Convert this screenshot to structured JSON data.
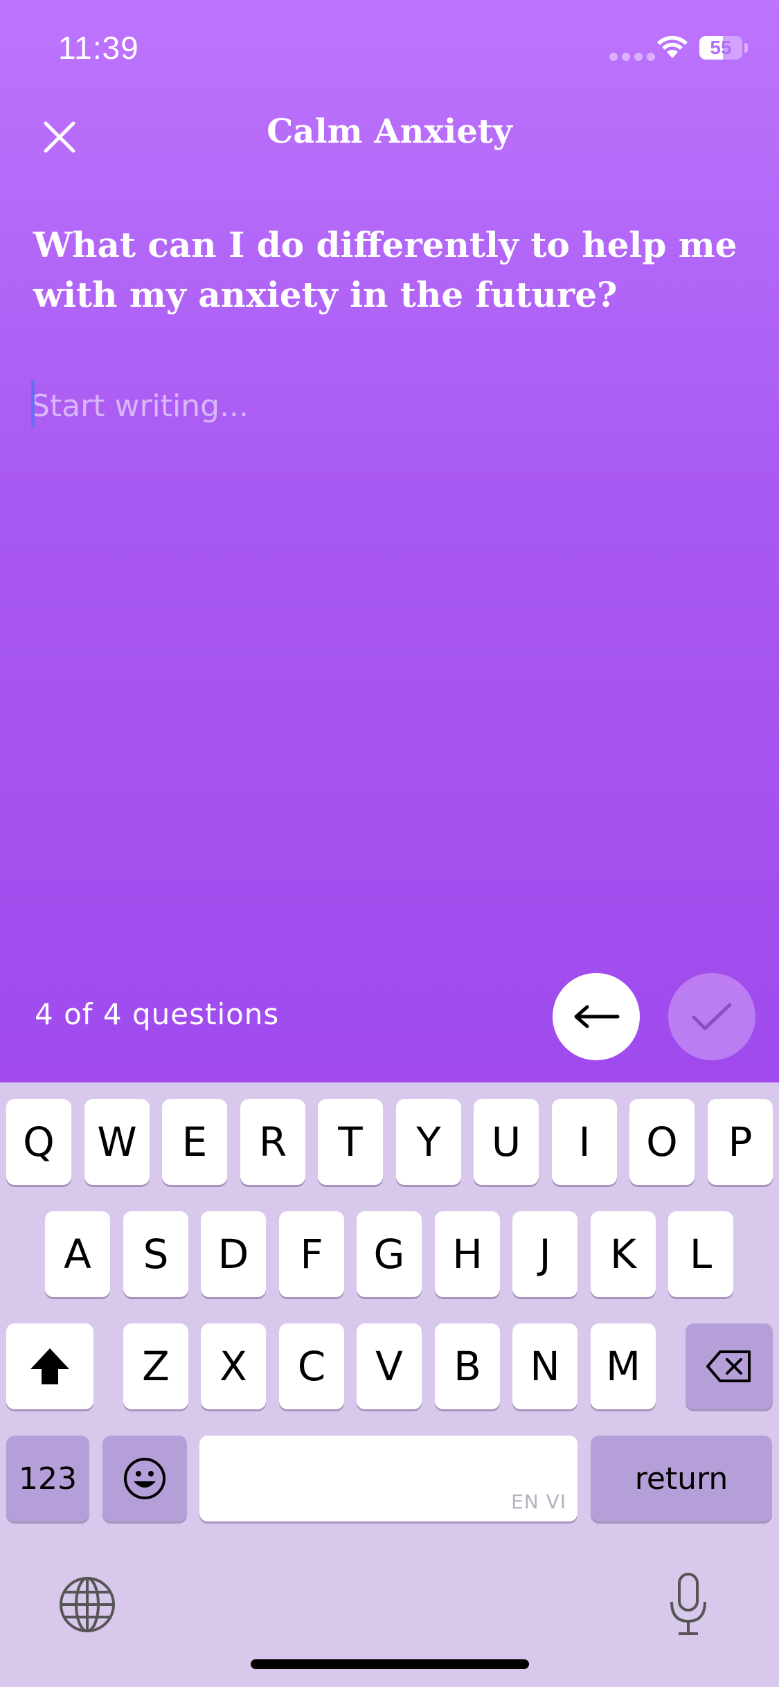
{
  "status_bar": {
    "time": "11:39",
    "battery": "55",
    "battery_level": 0.55
  },
  "nav": {
    "title": "Calm Anxiety"
  },
  "question": {
    "text": "What can I do differently to help me with my anxiety in the future?"
  },
  "answer": {
    "placeholder": "Start writing...",
    "value": ""
  },
  "footer": {
    "progress": "4 of 4 questions"
  },
  "keyboard": {
    "row1": [
      "Q",
      "W",
      "E",
      "R",
      "T",
      "Y",
      "U",
      "I",
      "O",
      "P"
    ],
    "row2": [
      "A",
      "S",
      "D",
      "F",
      "G",
      "H",
      "J",
      "K",
      "L"
    ],
    "row3": [
      "Z",
      "X",
      "C",
      "V",
      "B",
      "N",
      "M"
    ],
    "numbers_label": "123",
    "return_label": "return",
    "space_hint": "EN VI"
  },
  "colors": {
    "accent_top": "#bd74fd",
    "accent_bottom": "#a04aed",
    "caret": "#6a6cf4",
    "keyboard_bg": "#d8c8ec"
  }
}
